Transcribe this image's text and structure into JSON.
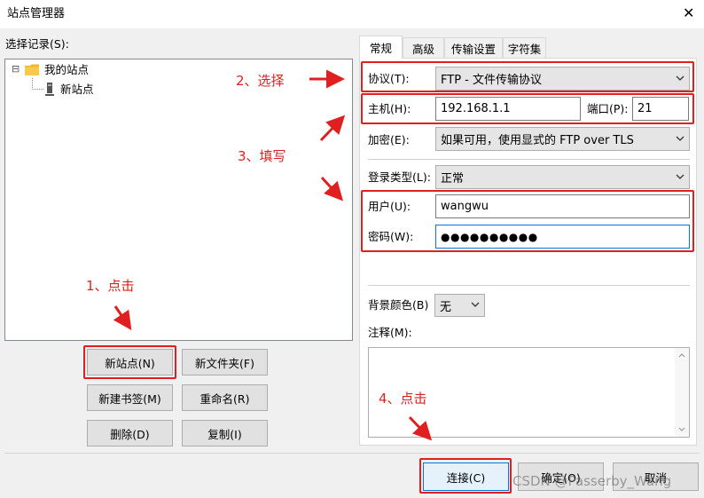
{
  "window": {
    "title": "站点管理器",
    "close_glyph": "✕"
  },
  "left": {
    "label": "选择记录(S):",
    "tree": {
      "root": "我的站点",
      "child": "新站点",
      "expander": "⊟"
    }
  },
  "buttons": {
    "new_site": "新站点(N)",
    "new_folder": "新文件夹(F)",
    "new_bookmark": "新建书签(M)",
    "rename": "重命名(R)",
    "delete": "删除(D)",
    "copy": "复制(I)",
    "connect": "连接(C)",
    "ok": "确定(O)",
    "cancel": "取消"
  },
  "tabs": [
    {
      "label": "常规"
    },
    {
      "label": "高级"
    },
    {
      "label": "传输设置"
    },
    {
      "label": "字符集"
    }
  ],
  "form": {
    "protocol_label": "协议(T):",
    "protocol_value": "FTP - 文件传输协议",
    "host_label": "主机(H):",
    "host_value": "192.168.1.1",
    "port_label": "端口(P):",
    "port_value": "21",
    "encryption_label": "加密(E):",
    "encryption_value": "如果可用，使用显式的 FTP over TLS",
    "logon_label": "登录类型(L):",
    "logon_value": "正常",
    "user_label": "用户(U):",
    "user_value": "wangwu",
    "password_label": "密码(W):",
    "password_value": "●●●●●●●●●●",
    "bgcolor_label": "背景颜色(B)",
    "bgcolor_value": "无",
    "comments_label": "注释(M):"
  },
  "annotations": {
    "step1": "1、点击",
    "step2": "2、选择",
    "step3": "3、填写",
    "step4": "4、点击"
  },
  "watermark": "CSDN @Passerby_Wang",
  "colors": {
    "annotation": "#e02020",
    "focus": "#0078d7"
  },
  "icons": {
    "tree_root": "folder-icon",
    "tree_child": "server-icon"
  }
}
